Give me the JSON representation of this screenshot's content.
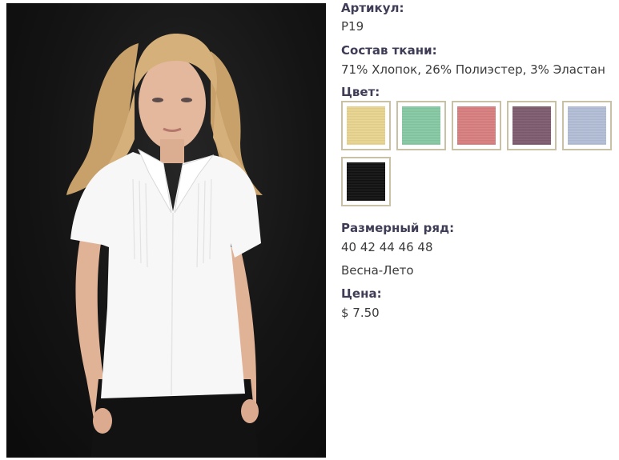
{
  "product": {
    "sku_label": "Артикул:",
    "sku_value": "P19",
    "fabric_label": "Состав ткани:",
    "fabric_value": "71% Хлопок, 26% Полиэстер, 3% Эластан",
    "color_label": "Цвет:",
    "colors": [
      {
        "name": "yellow-swatch",
        "hex": "#e9d48f"
      },
      {
        "name": "mint-swatch",
        "hex": "#86c9a3"
      },
      {
        "name": "coral-swatch",
        "hex": "#d87f80"
      },
      {
        "name": "mauve-swatch",
        "hex": "#7f5b6f"
      },
      {
        "name": "light-blue-swatch",
        "hex": "#b3bdd6"
      },
      {
        "name": "black-swatch",
        "hex": "#111112"
      }
    ],
    "size_label": "Размерный ряд:",
    "size_value": "40 42 44 46 48",
    "season_value": "Весна-Лето",
    "price_label": "Цена:",
    "price_value": "$ 7.50"
  }
}
